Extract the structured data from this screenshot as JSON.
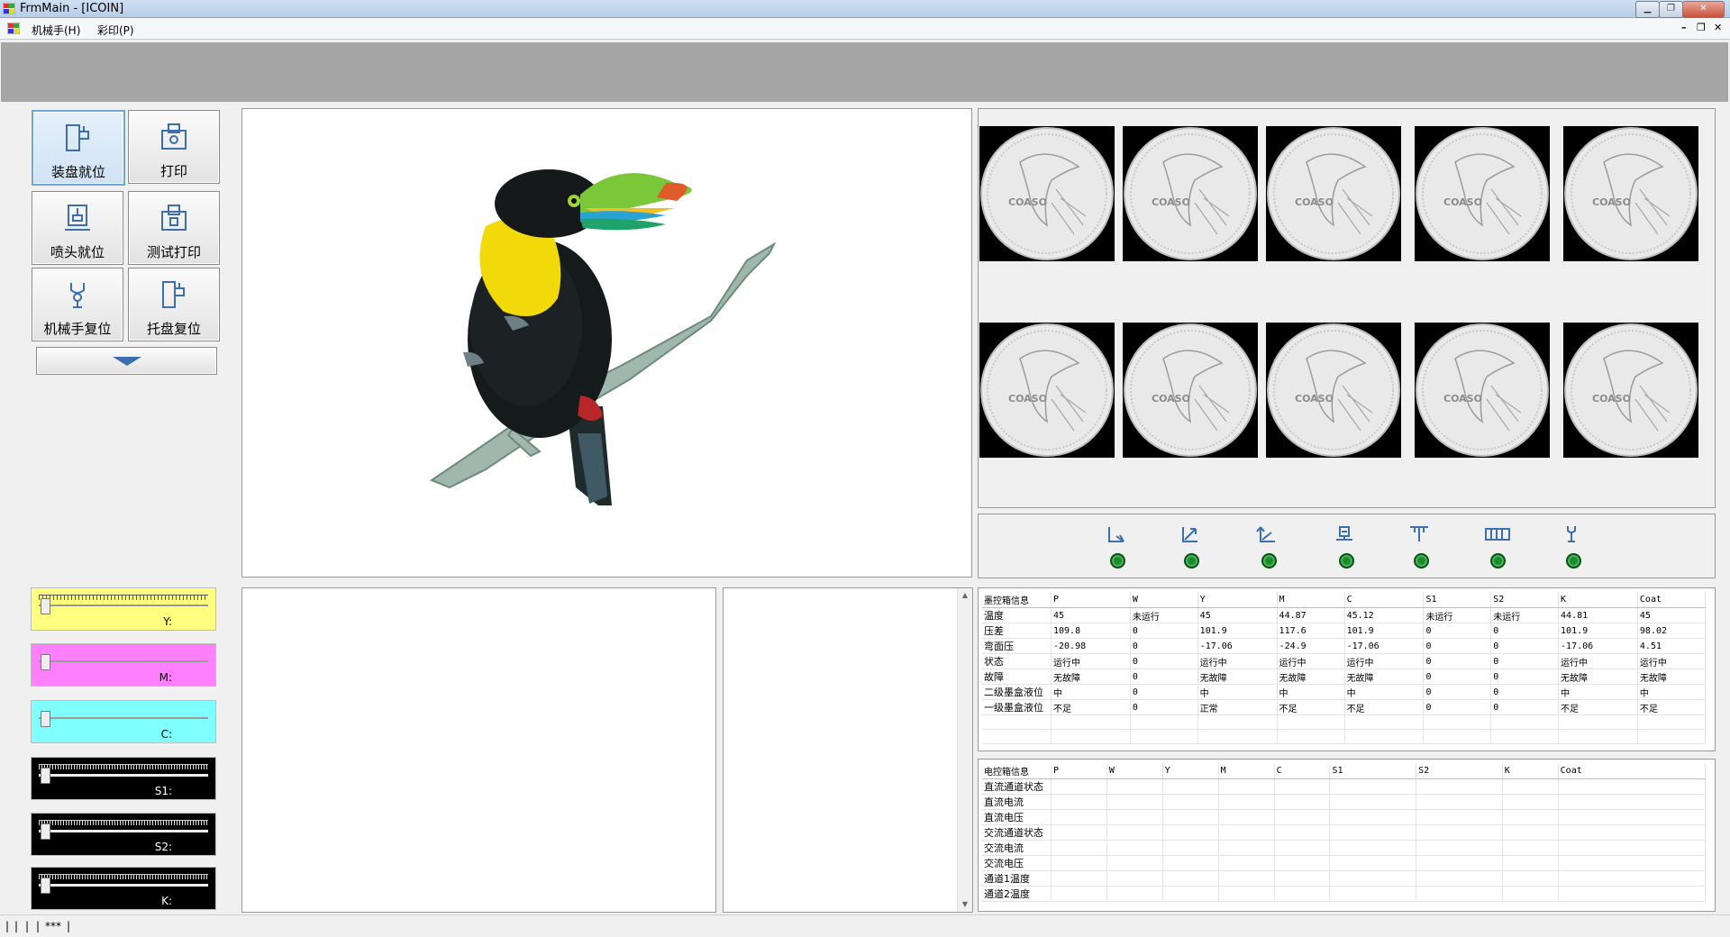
{
  "window": {
    "title": "FrmMain - [ICOIN]"
  },
  "menu": {
    "items": [
      "机械手(H)",
      "彩印(P)"
    ]
  },
  "controls": {
    "buttons": [
      "装盘就位",
      "打印",
      "喷头就位",
      "测试打印",
      "机械手复位",
      "托盘复位"
    ],
    "expand_icon": "chevron-down-icon"
  },
  "sliders": [
    {
      "label": "Y:",
      "color": "#ffff80",
      "value": 0
    },
    {
      "label": "M:",
      "color": "#ff80ff",
      "value": 0
    },
    {
      "label": "C:",
      "color": "#80ffff",
      "value": 0
    },
    {
      "label": "S1:",
      "color": "#000000",
      "value": 0
    },
    {
      "label": "S2:",
      "color": "#000000",
      "value": 0
    },
    {
      "label": "K:",
      "color": "#000000",
      "value": 0
    }
  ],
  "preview": {
    "subject": "toucan-on-branch-image"
  },
  "coins": {
    "count": 10,
    "text": "COASO"
  },
  "status_icons": [
    "axis-x-icon",
    "axis-diagonal-icon",
    "axis-z-icon",
    "printhead-icon",
    "gantry-icon",
    "tray-icon",
    "gripper-icon"
  ],
  "ink_box": {
    "title": "墨控箱信息",
    "columns": [
      "P",
      "W",
      "Y",
      "M",
      "C",
      "S1",
      "S2",
      "K",
      "Coat"
    ],
    "rows": [
      {
        "label": "温度",
        "values": [
          "45",
          "未运行",
          "45",
          "44.87",
          "45.12",
          "未运行",
          "未运行",
          "44.81",
          "45"
        ]
      },
      {
        "label": "压差",
        "values": [
          "109.8",
          "0",
          "101.9",
          "117.6",
          "101.9",
          "0",
          "0",
          "101.9",
          "98.02"
        ]
      },
      {
        "label": "弯面压",
        "values": [
          "-20.98",
          "0",
          "-17.06",
          "-24.9",
          "-17.06",
          "0",
          "0",
          "-17.06",
          "4.51"
        ]
      },
      {
        "label": "状态",
        "values": [
          "运行中",
          "0",
          "运行中",
          "运行中",
          "运行中",
          "0",
          "0",
          "运行中",
          "运行中"
        ]
      },
      {
        "label": "故障",
        "values": [
          "无故障",
          "0",
          "无故障",
          "无故障",
          "无故障",
          "0",
          "0",
          "无故障",
          "无故障"
        ]
      },
      {
        "label": "二级墨盒液位",
        "values": [
          "中",
          "0",
          "中",
          "中",
          "中",
          "0",
          "0",
          "中",
          "中"
        ]
      },
      {
        "label": "一级墨盒液位",
        "values": [
          "不足",
          "0",
          "正常",
          "不足",
          "不足",
          "0",
          "0",
          "不足",
          "不足"
        ]
      },
      {
        "label": "",
        "values": [
          "",
          "",
          "",
          "",
          "",
          "",
          "",
          "",
          ""
        ]
      },
      {
        "label": "",
        "values": [
          "",
          "",
          "",
          "",
          "",
          "",
          "",
          "",
          ""
        ]
      }
    ]
  },
  "elec_box": {
    "title": "电控箱信息",
    "columns": [
      "P",
      "W",
      "Y",
      "M",
      "C",
      "S1",
      "S2",
      "K",
      "Coat"
    ],
    "rows": [
      {
        "label": "直流通道状态",
        "values": [
          "",
          "",
          "",
          "",
          "",
          "",
          "",
          "",
          ""
        ]
      },
      {
        "label": "直流电流",
        "values": [
          "",
          "",
          "",
          "",
          "",
          "",
          "",
          "",
          ""
        ]
      },
      {
        "label": "直流电压",
        "values": [
          "",
          "",
          "",
          "",
          "",
          "",
          "",
          "",
          ""
        ]
      },
      {
        "label": "交流通道状态",
        "values": [
          "",
          "",
          "",
          "",
          "",
          "",
          "",
          "",
          ""
        ]
      },
      {
        "label": "交流电流",
        "values": [
          "",
          "",
          "",
          "",
          "",
          "",
          "",
          "",
          ""
        ]
      },
      {
        "label": "交流电压",
        "values": [
          "",
          "",
          "",
          "",
          "",
          "",
          "",
          "",
          ""
        ]
      },
      {
        "label": "通道1温度",
        "values": [
          "",
          "",
          "",
          "",
          "",
          "",
          "",
          "",
          ""
        ]
      },
      {
        "label": "通道2温度",
        "values": [
          "",
          "",
          "",
          "",
          "",
          "",
          "",
          "",
          ""
        ]
      }
    ]
  },
  "statusbar": {
    "items": [
      "|",
      "|",
      "|",
      "|",
      "***",
      "|"
    ]
  }
}
